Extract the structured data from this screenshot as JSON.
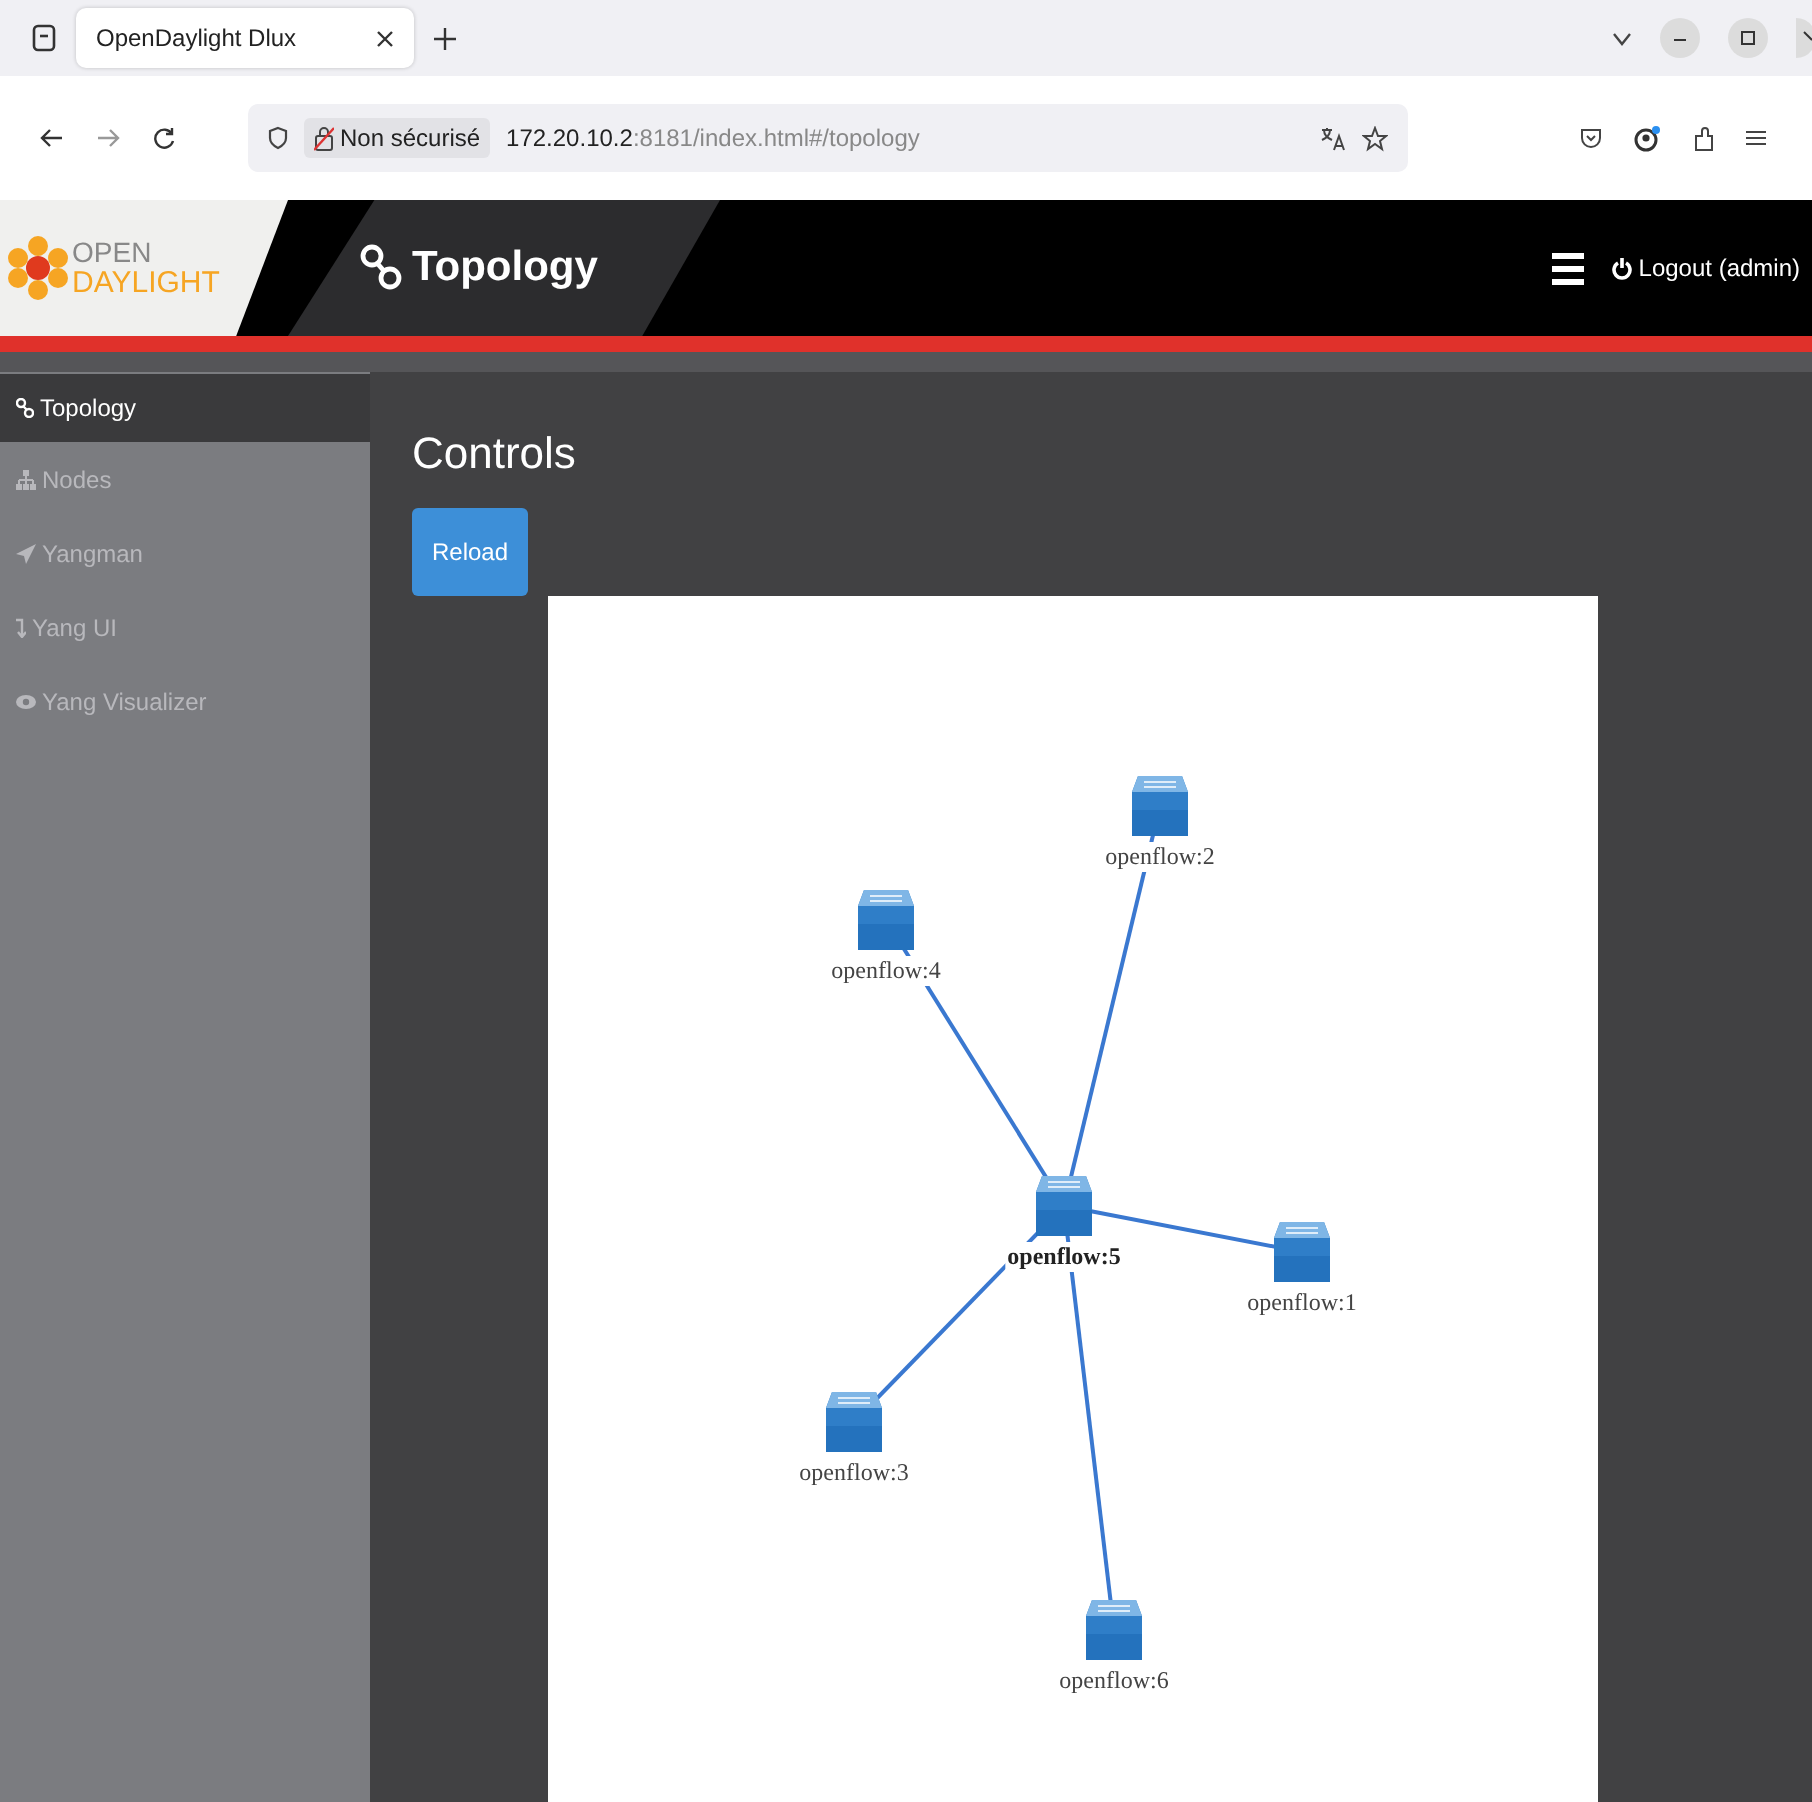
{
  "browser": {
    "tab": {
      "title": "OpenDaylight Dlux",
      "selected": true
    },
    "url": {
      "security": "Non sécurisé",
      "host": "172.20.10.2",
      "rest": ":8181/index.html#/topology"
    }
  },
  "header": {
    "logo_top": "OPEN",
    "logo_bottom": "DAYLIGHT",
    "title": "Topology",
    "logout": "Logout (admin)"
  },
  "sidebar": {
    "items": [
      {
        "label": "Topology",
        "selected": true
      },
      {
        "label": "Nodes",
        "selected": false
      },
      {
        "label": "Yangman",
        "selected": false
      },
      {
        "label": "Yang UI",
        "selected": false
      },
      {
        "label": "Yang Visualizer",
        "selected": false
      }
    ]
  },
  "main": {
    "heading": "Controls",
    "button": "Reload"
  },
  "topology": {
    "nodes": [
      {
        "label": "openflow:2",
        "selected": false
      },
      {
        "label": "openflow:4",
        "selected": false
      },
      {
        "label": "openflow:5",
        "selected": true
      },
      {
        "label": "openflow:1",
        "selected": false
      },
      {
        "label": "openflow:3",
        "selected": false
      },
      {
        "label": "openflow:6",
        "selected": false
      }
    ]
  }
}
